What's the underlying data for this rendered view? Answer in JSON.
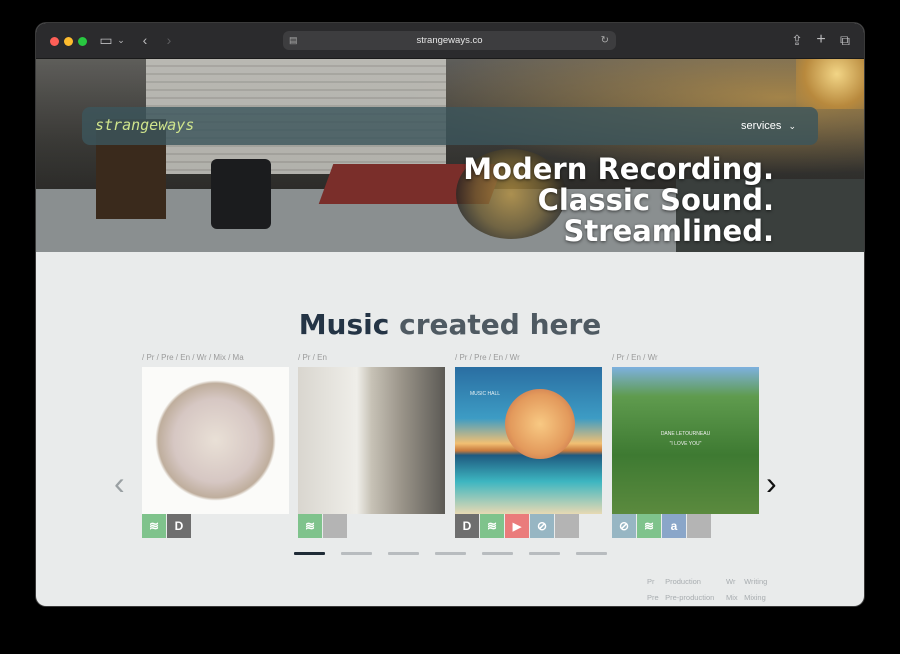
{
  "browser": {
    "url": "strangeways.co"
  },
  "navbar": {
    "logo": "strangeways",
    "services_label": "services"
  },
  "hero": {
    "lines": [
      "Modern Recording.",
      "Classic Sound.",
      "Streamlined."
    ]
  },
  "section": {
    "title_part1": "Music",
    "title_part2": "created here"
  },
  "albums": [
    {
      "credits": "/ Pr / Pre / En / Wr / Mix / Ma",
      "links": [
        {
          "name": "spotify",
          "glyph": "≋"
        },
        {
          "name": "deezer",
          "glyph": "D"
        }
      ]
    },
    {
      "credits": "/ Pr / En",
      "links": [
        {
          "name": "spotify",
          "glyph": "≋"
        },
        {
          "name": "apple",
          "glyph": ""
        }
      ]
    },
    {
      "credits": "/ Pr / Pre / En / Wr",
      "cover_text": "MUSIC HALL",
      "links": [
        {
          "name": "deezer",
          "glyph": "D"
        },
        {
          "name": "spotify",
          "glyph": "≋"
        },
        {
          "name": "youtube",
          "glyph": "▶"
        },
        {
          "name": "safari",
          "glyph": "⊘"
        },
        {
          "name": "apple",
          "glyph": ""
        }
      ]
    },
    {
      "credits": "/ Pr / En / Wr",
      "cover_text1": "DANE LETOURNEAU",
      "cover_text2": "\"I LOVE YOU\"",
      "links": [
        {
          "name": "safari",
          "glyph": "⊘"
        },
        {
          "name": "spotify",
          "glyph": "≋"
        },
        {
          "name": "amazon",
          "glyph": "a"
        },
        {
          "name": "apple",
          "glyph": ""
        }
      ]
    }
  ],
  "carousel": {
    "prev_glyph": "‹",
    "next_glyph": "›",
    "pages": 7,
    "active_page": 1
  },
  "legend": {
    "items": [
      {
        "abbr": "Pr",
        "label": "Production"
      },
      {
        "abbr": "Wr",
        "label": "Writing"
      },
      {
        "abbr": "Pre",
        "label": "Pre-production"
      },
      {
        "abbr": "Mix",
        "label": "Mixing"
      }
    ]
  },
  "colors": {
    "accent_logo": "#cfe48c",
    "title_dark": "#243445",
    "title_grey": "#4f5a62",
    "pager_active": "#1f2b36"
  }
}
